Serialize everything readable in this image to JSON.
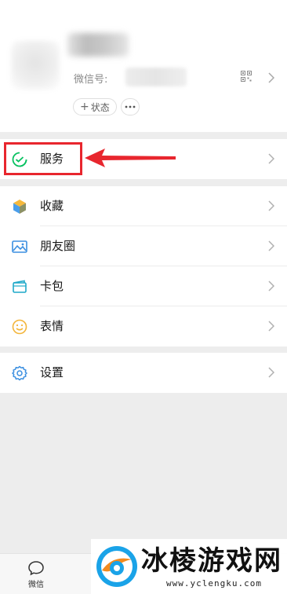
{
  "profile": {
    "wechat_id_label": "微信号:",
    "status_label": "状态",
    "more_label": "···"
  },
  "menu": {
    "services": "服务",
    "favorites": "收藏",
    "moments": "朋友圈",
    "cards": "卡包",
    "stickers": "表情",
    "settings": "设置"
  },
  "tabbar": {
    "chats": "微信"
  },
  "watermark": {
    "title": "冰棱游戏网",
    "url": "www.yclengku.com"
  },
  "colors": {
    "highlight": "#e8262e",
    "accent_green": "#07c160"
  }
}
